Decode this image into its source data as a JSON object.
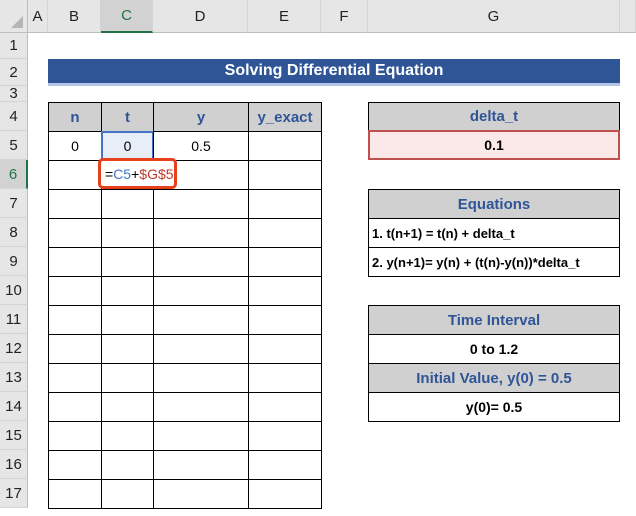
{
  "columns": [
    "A",
    "B",
    "C",
    "D",
    "E",
    "F",
    "G"
  ],
  "rows": [
    "1",
    "2",
    "3",
    "4",
    "5",
    "6",
    "7",
    "8",
    "9",
    "10",
    "11",
    "12",
    "13",
    "14",
    "15",
    "16",
    "17"
  ],
  "title": "Solving Differential Equation",
  "table": {
    "headers": [
      "n",
      "t",
      "y",
      "y_exact"
    ],
    "row5": [
      "0",
      "0",
      "0.5",
      ""
    ]
  },
  "formula": {
    "eq": "=",
    "ref1": "C5",
    "plus": "+",
    "ref2": "$G$5"
  },
  "delta": {
    "label": "delta_t",
    "value": "0.1"
  },
  "equations": {
    "label": "Equations",
    "eq1": "1. t(n+1) = t(n) + delta_t",
    "eq2": "2. y(n+1)= y(n) + (t(n)-y(n))*delta_t"
  },
  "interval": {
    "label": "Time Interval",
    "value": "0 to 1.2",
    "init_label": "Initial Value, y(0) = 0.5",
    "init_value": "y(0)= 0.5"
  },
  "colors": {
    "title_bg": "#2f5597",
    "header_text": "#2f5597",
    "formula_border": "#e8401c",
    "ref1": "#3f78c8",
    "ref2": "#c0392b"
  }
}
